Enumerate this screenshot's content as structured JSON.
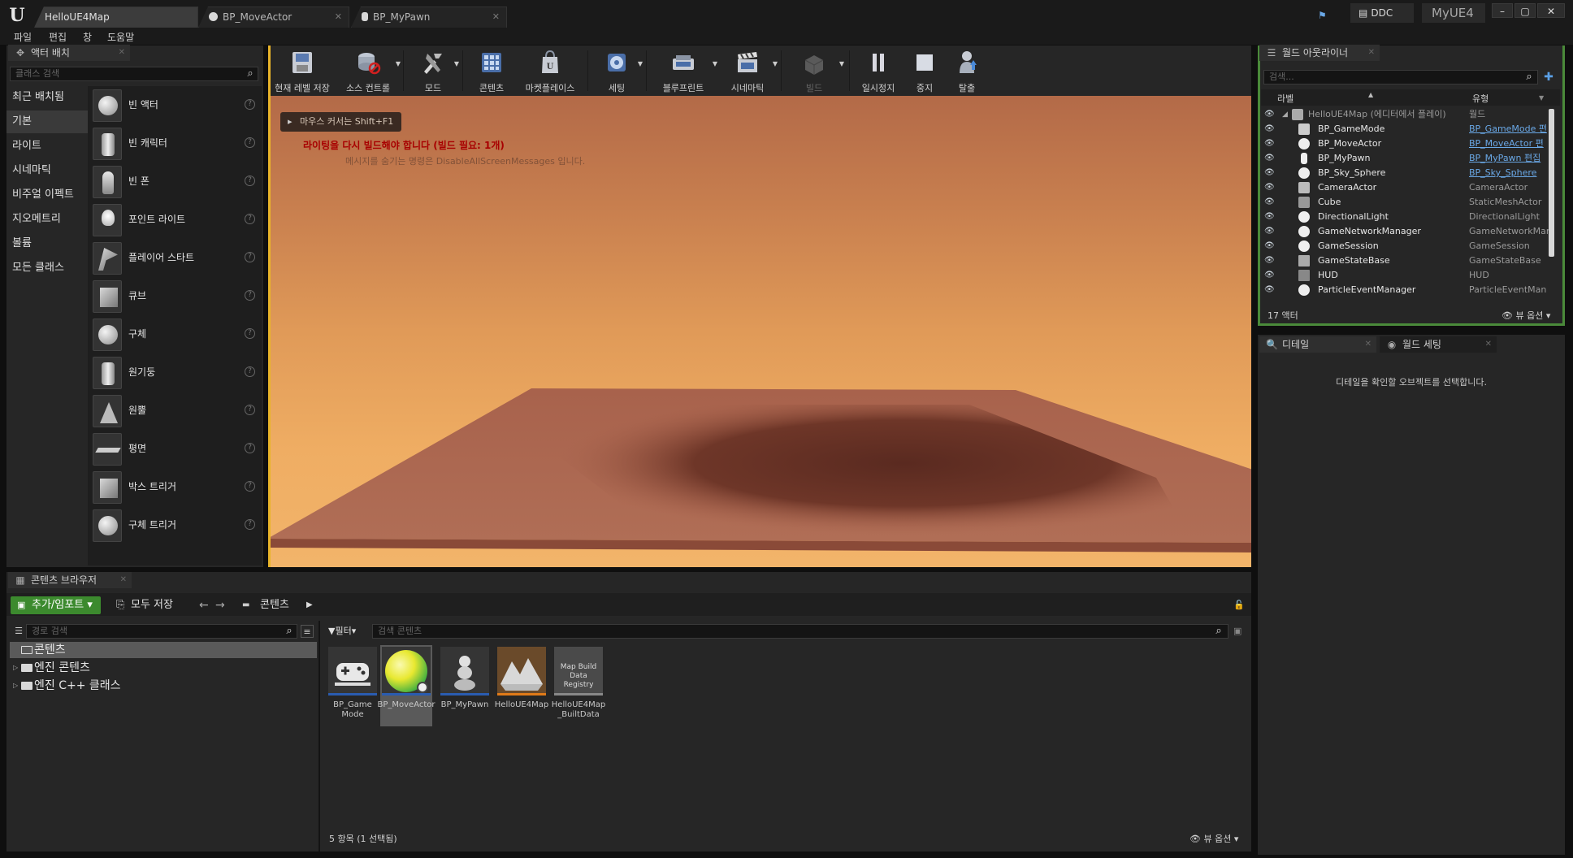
{
  "window": {
    "tabs": [
      {
        "label": "HelloUE4Map"
      },
      {
        "label": "BP_MoveActor"
      },
      {
        "label": "BP_MyPawn"
      }
    ],
    "ddc_label": "DDC",
    "project_name": "MyUE4",
    "win_buttons": {
      "minimize": "–",
      "maximize": "▢",
      "close": "✕"
    }
  },
  "menu": {
    "items": [
      "파일",
      "편집",
      "창",
      "도움말"
    ]
  },
  "place_actors": {
    "tab_label": "액터 배치",
    "search_placeholder": "클래스 검색",
    "categories": [
      "최근 배치됨",
      "기본",
      "라이트",
      "시네마틱",
      "비주얼 이펙트",
      "지오메트리",
      "볼륨",
      "모든 클래스"
    ],
    "active_category": "기본",
    "items": [
      {
        "label": "빈 액터",
        "icon": "sphere"
      },
      {
        "label": "빈 캐릭터",
        "icon": "character"
      },
      {
        "label": "빈 폰",
        "icon": "pawn"
      },
      {
        "label": "포인트 라이트",
        "icon": "light"
      },
      {
        "label": "플레이어 스타트",
        "icon": "flag"
      },
      {
        "label": "큐브",
        "icon": "cube"
      },
      {
        "label": "구체",
        "icon": "sphere"
      },
      {
        "label": "원기둥",
        "icon": "cylinder"
      },
      {
        "label": "원뿔",
        "icon": "cone"
      },
      {
        "label": "평면",
        "icon": "plane"
      },
      {
        "label": "박스 트리거",
        "icon": "box-trigger"
      },
      {
        "label": "구체 트리거",
        "icon": "sphere-trigger"
      }
    ]
  },
  "toolbar": {
    "buttons": [
      {
        "label": "현재 레벨 저장",
        "icon": "save"
      },
      {
        "label": "소스 컨트롤",
        "icon": "source-control"
      },
      {
        "label": "모드",
        "icon": "modes"
      },
      {
        "label": "콘텐츠",
        "icon": "content"
      },
      {
        "label": "마켓플레이스",
        "icon": "marketplace"
      },
      {
        "label": "세팅",
        "icon": "settings"
      },
      {
        "label": "블루프린트",
        "icon": "blueprint"
      },
      {
        "label": "시네마틱",
        "icon": "cinematics"
      },
      {
        "label": "빌드",
        "icon": "build"
      },
      {
        "label": "일시정지",
        "icon": "pause"
      },
      {
        "label": "중지",
        "icon": "stop"
      },
      {
        "label": "탈출",
        "icon": "eject"
      }
    ]
  },
  "viewport": {
    "mouse_hint": "마우스 커서는 Shift+F1",
    "warning": "라이팅을 다시 빌드해야 합니다 (빌드 필요: 1개)",
    "info": "메시지를 숨기는 명령은 DisableAllScreenMessages 입니다."
  },
  "outliner": {
    "tab_label": "월드 아웃라이너",
    "search_placeholder": "검색...",
    "columns": {
      "label": "라벨",
      "type": "유형"
    },
    "root": {
      "name": "HelloUE4Map (에디터에서 플레이)",
      "type": "월드"
    },
    "rows": [
      {
        "name": "BP_GameMode",
        "type": "BP_GameMode 편"
      },
      {
        "name": "BP_MoveActor",
        "type": "BP_MoveActor 편"
      },
      {
        "name": "BP_MyPawn",
        "type": "BP_MyPawn 편집"
      },
      {
        "name": "BP_Sky_Sphere",
        "type": "BP_Sky_Sphere"
      },
      {
        "name": "CameraActor",
        "type": "CameraActor"
      },
      {
        "name": "Cube",
        "type": "StaticMeshActor"
      },
      {
        "name": "DirectionalLight",
        "type": "DirectionalLight"
      },
      {
        "name": "GameNetworkManager",
        "type": "GameNetworkMan"
      },
      {
        "name": "GameSession",
        "type": "GameSession"
      },
      {
        "name": "GameStateBase",
        "type": "GameStateBase"
      },
      {
        "name": "HUD",
        "type": "HUD"
      },
      {
        "name": "ParticleEventManager",
        "type": "ParticleEventMan"
      }
    ],
    "count": "17 액터",
    "view_options": "뷰 옵션"
  },
  "details": {
    "tabs": [
      "디테일",
      "월드 세팅"
    ],
    "message": "디테일을 확인할 오브젝트를 선택합니다."
  },
  "content_browser": {
    "tab_label": "콘텐츠 브라우저",
    "add_import": "추가/임포트",
    "save_all": "모두 저장",
    "breadcrumb": "콘텐츠",
    "path_search_placeholder": "경로 검색",
    "tree": [
      "콘텐츠",
      "엔진 콘텐츠",
      "엔진 C++ 클래스"
    ],
    "filter_label": "필터",
    "asset_search_placeholder": "검색 콘텐츠",
    "assets": [
      {
        "name": "BP_Game Mode",
        "thumb": "gamepad"
      },
      {
        "name": "BP_MoveActor",
        "thumb": "sphere"
      },
      {
        "name": "BP_MyPawn",
        "thumb": "pawn"
      },
      {
        "name": "HelloUE4Map",
        "thumb": "map"
      },
      {
        "name": "HelloUE4Map _BuiltData",
        "thumb": "Map Build Data Registry"
      }
    ],
    "item_count": "5 항목 (1 선택됨)",
    "view_options": "뷰 옵션"
  }
}
